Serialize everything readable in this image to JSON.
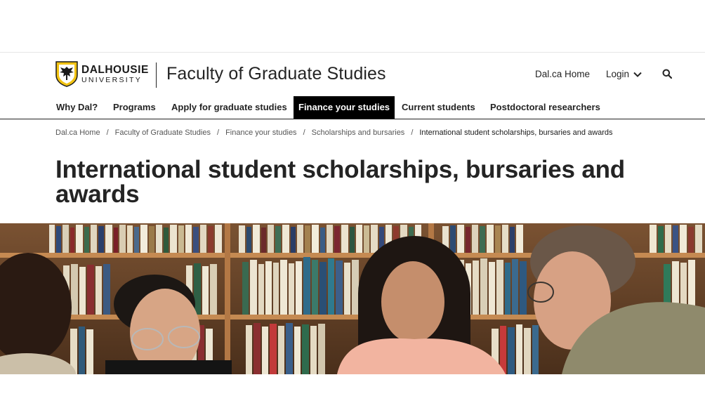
{
  "brand": {
    "name_top": "DALHOUSIE",
    "name_bottom": "UNIVERSITY",
    "site_title": "Faculty of Graduate Studies"
  },
  "utility": {
    "home_label": "Dal.ca Home",
    "login_label": "Login",
    "search_icon": "search-icon"
  },
  "nav": {
    "items": [
      {
        "label": "Why Dal?"
      },
      {
        "label": "Programs"
      },
      {
        "label": "Apply for graduate studies"
      },
      {
        "label": "Finance your studies",
        "active": true
      },
      {
        "label": "Current students"
      },
      {
        "label": "Postdoctoral researchers"
      }
    ]
  },
  "breadcrumb": {
    "items": [
      "Dal.ca Home",
      "Faculty of Graduate Studies",
      "Finance your studies",
      "Scholarships and bursaries",
      "International student scholarships, bursaries and awards"
    ],
    "separator": "/"
  },
  "page": {
    "title": "International student scholarships, bursaries and awards"
  },
  "colors": {
    "text": "#242424",
    "active_nav_bg": "#000000",
    "shield_gold": "#f2c313"
  }
}
